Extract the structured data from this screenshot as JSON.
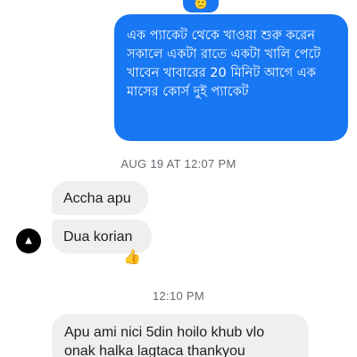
{
  "messages": {
    "outgoing_text": "এক প্যাকেট থেকে খাওয়া শুরু করেন সকালে একটা রাতে একটা খালি পেটে খাবেন খাবারের 20 মিনিট আগে এক মাসের কোর্স দুই প্যাকেট",
    "timestamp_1": "AUG 19 AT 12:07 PM",
    "incoming_1": "Accha apu",
    "incoming_2": "Dua korian",
    "timestamp_2": "12:10 PM",
    "incoming_3": "Apu ami nici 5din hoilo khub vlo onak halka lagtaca thankyou"
  },
  "icons": {
    "top_bubble_glyph": "🙂",
    "avatar_glyph": "▲",
    "reaction_glyph": "👍"
  },
  "colors": {
    "outgoing_bubble": "#1877f2",
    "incoming_bubble": "#efefef",
    "timestamp_text": "#666a70"
  }
}
